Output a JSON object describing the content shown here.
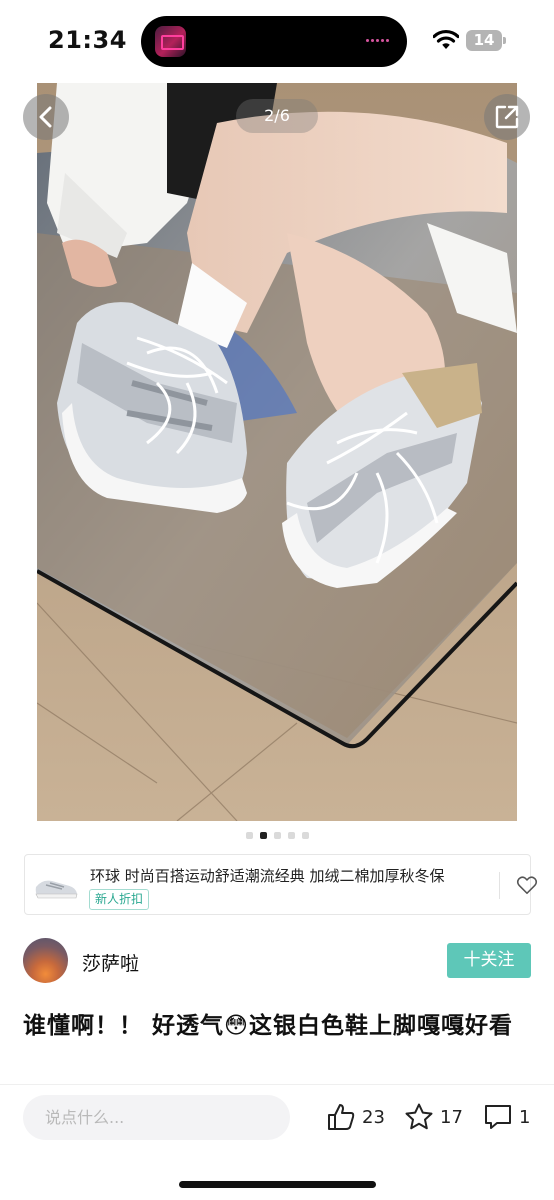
{
  "status_bar": {
    "time": "21:34",
    "battery": "14",
    "icons": [
      "wifi-icon",
      "battery-icon"
    ]
  },
  "photo": {
    "page_indicator": "2/6",
    "current_index": 2,
    "total": 6,
    "icons": [
      "back-arrow-icon",
      "share-external-icon"
    ]
  },
  "product": {
    "title": "环球 时尚百搭运动舒适潮流经典 加绒二棉加厚秋冬保",
    "badge": "新人折扣"
  },
  "author": {
    "name": "莎萨啦",
    "follow_label": "十关注"
  },
  "post": {
    "text": "谁懂啊！！ 好透气😳这银白色鞋上脚嘎嘎好看"
  },
  "bottom_bar": {
    "comment_placeholder": "说点什么...",
    "likes": "23",
    "favorites": "17",
    "comments": "1"
  },
  "colors": {
    "accent": "#5ec7b8",
    "badge_text": "#2aa891",
    "island_dots": "#d7559f"
  }
}
